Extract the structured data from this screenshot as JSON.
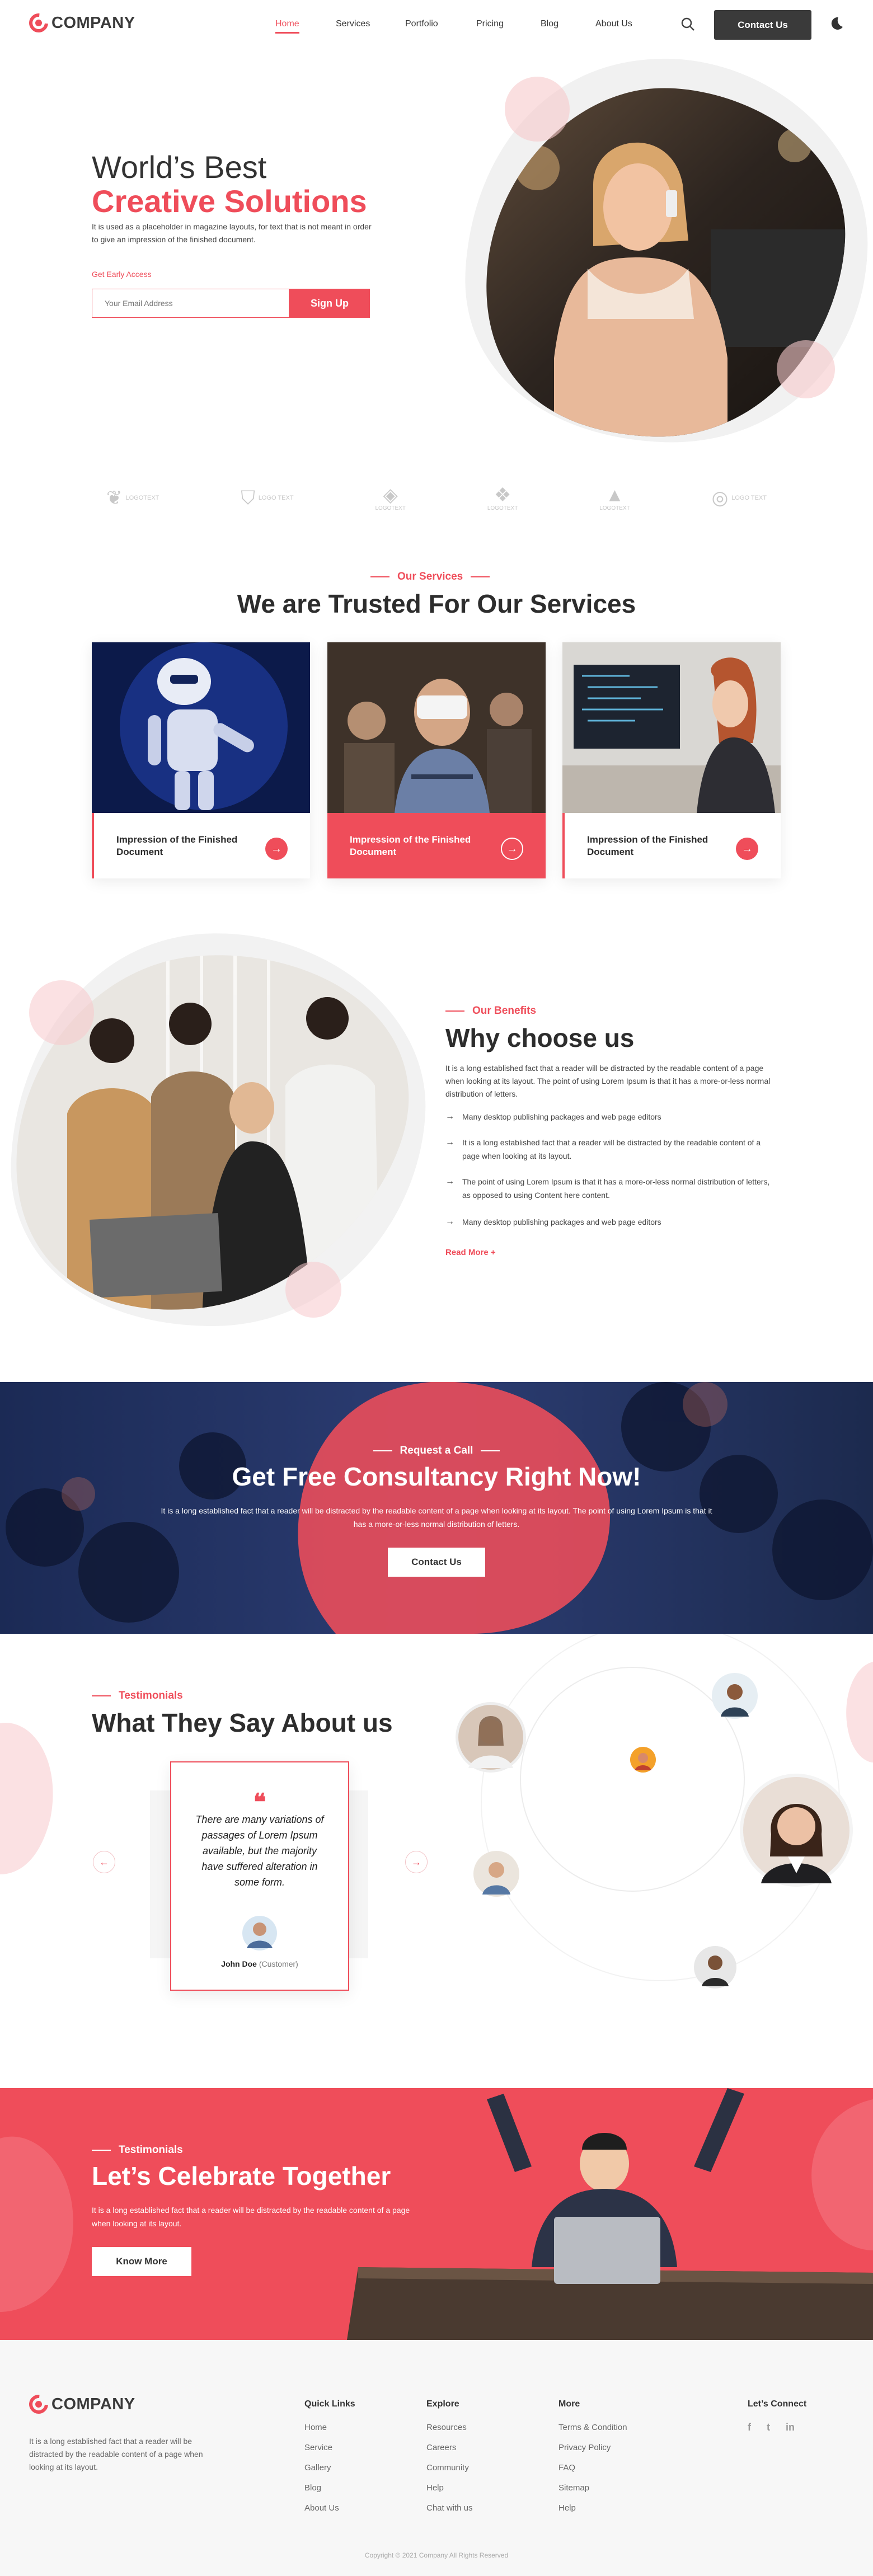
{
  "brand": {
    "name": "COMPANY",
    "accent": "#ef4d5a",
    "dark": "#3a3a3a"
  },
  "nav": {
    "items": [
      "Home",
      "Services",
      "Portfolio",
      "Pricing",
      "Blog",
      "About Us"
    ],
    "contact": "Contact Us"
  },
  "hero": {
    "line1": "World’s Best",
    "line2": "Creative Solutions",
    "body": "It is used as a placeholder in magazine layouts, for text that is not meant in order to give an impression of the finished document.",
    "access": "Get Early Access",
    "placeholder": "Your Email Address",
    "signup": "Sign Up"
  },
  "logos": [
    "LOGOTEXT",
    "LOGO TEXT",
    "LOGOTEXT",
    "LOGOTEXT",
    "LOGOTEXT",
    "LOGO TEXT"
  ],
  "services": {
    "eyebrow": "Our Services",
    "title": "We are Trusted For Our Services",
    "cards": [
      "Impression of the Finished Document",
      "Impression of the Finished Document",
      "Impression of the Finished Document"
    ]
  },
  "benefits": {
    "eyebrow": "Our Benefits",
    "title": "Why choose us",
    "body": "It is a long established fact that a reader will be distracted by the readable content of a page when looking at its layout. The point of using Lorem Ipsum is that it has a more-or-less normal distribution of letters.",
    "bullets": [
      "Many desktop publishing packages and web page editors",
      "It is a long established fact that a reader will be distracted by the readable content of a page when looking at its layout.",
      "The point of using Lorem Ipsum is that it has a more-or-less normal distribution of letters, as opposed to using Content here content.",
      "Many desktop publishing packages and web page editors"
    ],
    "more": "Read More +"
  },
  "cta": {
    "eyebrow": "Request a Call",
    "title": "Get Free Consultancy Right Now!",
    "body": "It is a long established fact that a reader will be distracted by the readable content of a page when looking at its layout. The point of using Lorem Ipsum is that it has a more-or-less normal distribution of letters.",
    "button": "Contact Us"
  },
  "testimonials": {
    "eyebrow": "Testimonials",
    "title": "What They Say About us",
    "quote": "There are many variations of passages of Lorem Ipsum available, but the majority have suffered alteration in some form.",
    "name": "John Doe",
    "role": "(Customer)"
  },
  "celebrate": {
    "eyebrow": "Testimonials",
    "title": "Let’s Celebrate Together",
    "body": "It is a long established fact that a reader will be distracted by the readable content of a page when looking at its layout.",
    "button": "Know More"
  },
  "footer": {
    "about": "It is a long established fact that a reader will be distracted by the readable content of a page when looking at its layout.",
    "quick": {
      "title": "Quick Links",
      "items": [
        "Home",
        "Service",
        "Gallery",
        "Blog",
        "About Us"
      ]
    },
    "explore": {
      "title": "Explore",
      "items": [
        "Resources",
        "Careers",
        "Community",
        "Help",
        "Chat with us"
      ]
    },
    "more": {
      "title": "More",
      "items": [
        "Terms & Condition",
        "Privacy Policy",
        "FAQ",
        "Sitemap",
        "Help"
      ]
    },
    "connect": "Let’s Connect",
    "social": [
      "f",
      "t",
      "in"
    ],
    "copyright": "Copyright © 2021 Company All Rights Reserved"
  }
}
